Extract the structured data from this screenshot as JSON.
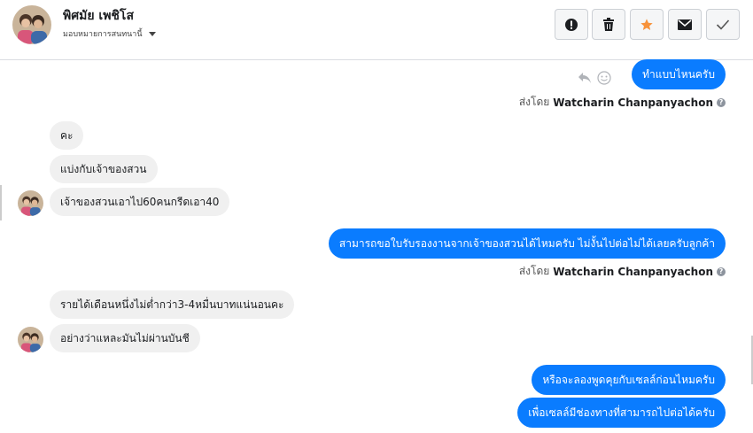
{
  "header": {
    "name": "พิศมัย เพชิโส",
    "assign": "มอบหมายการสนทนานี้"
  },
  "toolbar": {
    "spam_icon": "alert-icon",
    "delete_icon": "trash-icon",
    "star_icon": "star-icon",
    "mail_icon": "mail-icon",
    "done_icon": "check-icon",
    "star_color": "#f7923b"
  },
  "messages": {
    "out1": "ทำแบบไหนครับ",
    "sent_prefix1": "ส่งโดย",
    "sender1": "Watcharin Chanpanyachon",
    "in1": "คะ",
    "in2": "แบ่งกับเจ้าของสวน",
    "in3": "เจ้าของสวนเอาไป60คนกรีดเอา40",
    "out2": "สามารถขอใบรับรองงานจากเจ้าของสวนได้ไหมครับ ไม่งั้นไปต่อไม่ได้เลยครับลูกค้า",
    "sent_prefix2": "ส่งโดย",
    "sender2": "Watcharin Chanpanyachon",
    "in4": "รายได้เดือนหนึ่งไม่ต่ำกว่า3-4หมื่นบาทแน่นอนคะ",
    "in5": "อย่างว่าแหละมันไม่ผ่านบันชี",
    "out3": "หรือจะลองพูดคุยกับเซลล์ก่อนไหมครับ",
    "out4": "เพื่อเซลล์มีช่องทางที่สามารถไปต่อได้ครับ"
  },
  "colors": {
    "outgoing_bubble": "#0a7cff",
    "incoming_bubble": "#f0f0f0"
  }
}
